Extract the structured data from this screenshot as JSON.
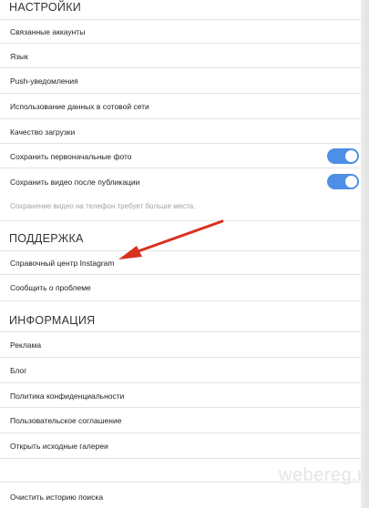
{
  "sections": {
    "settings_title": "НАСТРОЙКИ",
    "support_title": "ПОДДЕРЖКА",
    "info_title": "ИНФОРМАЦИЯ"
  },
  "settings": {
    "linked_accounts": "Связанные аккаунты",
    "language": "Язык",
    "push": "Push-уведомления",
    "cellular_data": "Использование данных в сотовой сети",
    "upload_quality": "Качество загрузки",
    "save_original_photos": "Сохранить первоначальные фото",
    "save_original_photos_on": true,
    "save_videos": "Сохранить видео после публикации",
    "save_videos_on": true,
    "save_videos_hint": "Сохранение видео на телефон требует больше места."
  },
  "support": {
    "help_center": "Справочный центр Instagram",
    "report_problem": "Сообщить о проблеме"
  },
  "info": {
    "ads": "Реклама",
    "blog": "Блог",
    "privacy_policy": "Политика конфиденциальности",
    "terms": "Пользовательское соглашение",
    "open_source": "Открыть исходные галереи"
  },
  "bottom": {
    "clear_search": "Очистить историю поиска"
  },
  "watermark": "webereg.ru",
  "colors": {
    "toggle_on": "#4d8fe6",
    "arrow": "#d9301f"
  }
}
